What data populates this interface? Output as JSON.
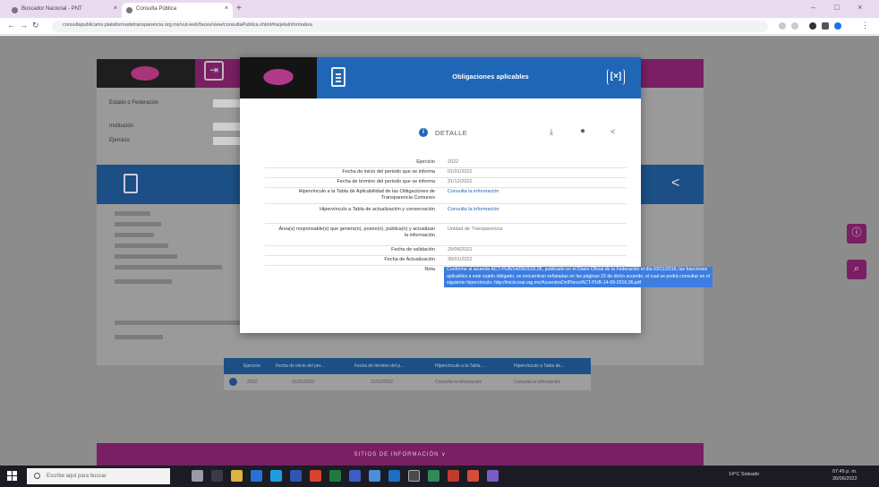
{
  "browser": {
    "tabs": [
      {
        "label": "Buscador Nacional - PNT"
      },
      {
        "label": "Consulta Pública"
      }
    ],
    "new_tab": "+",
    "url": "consultapublicamx.plataformadetransparencia.org.mx/vut-web/faces/view/consultaPublica.xhtml#tarjetaInformativa"
  },
  "page": {
    "form_labels": [
      "Estado o Federación",
      "Institución",
      "Ejercicio"
    ],
    "bar_icon": "document-icon",
    "share_icon": "share-icon",
    "table_headers": [
      "Ejercicio",
      "Fecha de inicio del per...",
      "Fecha de término del p...",
      "Hipervínculo a la Tabla ...",
      "Hipervínculo a Tabla de..."
    ],
    "table_row": [
      "2022",
      "01/01/2022",
      "31/12/2022",
      "Consulta la información",
      "Consulta la información"
    ],
    "footer": "SITIOS DE INFORMACIÓN ∨"
  },
  "modal": {
    "title": "Obligaciones aplicables",
    "close": "[×]",
    "detalle": "DETALLE",
    "rows": [
      {
        "label": "Ejercicio",
        "value": "2022",
        "link": false
      },
      {
        "label": "Fecha de inicio del periodo que se informa",
        "value": "01/01/2022",
        "link": false
      },
      {
        "label": "Fecha de término del periodo que se informa",
        "value": "31/12/2022",
        "link": false
      },
      {
        "label": "Hipervínculo a la Tabla de Aplicabilidad de las Obligaciones de Transparencia Comunes",
        "value": "Consulta la información",
        "link": true
      },
      {
        "label": "Hipervínculo a Tabla de actualización y conservación",
        "value": "Consulta la información",
        "link": true
      },
      {
        "label": "Área(s) responsable(s) que genera(n), posee(n), publica(n) y actualizan la información",
        "value": "Unidad de Transparencia",
        "link": false
      },
      {
        "label": "Fecha de validación",
        "value": "29/06/2022",
        "link": false
      },
      {
        "label": "Fecha de Actualización",
        "value": "30/01/2022",
        "link": false
      }
    ],
    "nota_label": "Nota",
    "nota_text": "Conforme al acuerdo ACT-PUB/14/09/2016.06, publicado en el Diario Oficial de la Federación el día 03/11/2016, las fracciones aplicables a este sujeto obligado, se encuentran señaladas en las páginas 22 de dicho acuerdo, el cual se podrá consultar en el siguiente hipervínculo: http://inicio.inai.org.mx/AcuerdosDelPleno/ACT-PUB-14-09-2016.06.pdf"
  },
  "taskbar": {
    "search_placeholder": "Escribe aquí para buscar",
    "tray": "14°C Soleado",
    "clock_time": "07:45 p. m.",
    "clock_date": "30/06/2022"
  },
  "colors": {
    "header_blue": "#1f66b6",
    "brand_magenta": "#7a1f63",
    "selection_blue": "#3d7de0"
  }
}
